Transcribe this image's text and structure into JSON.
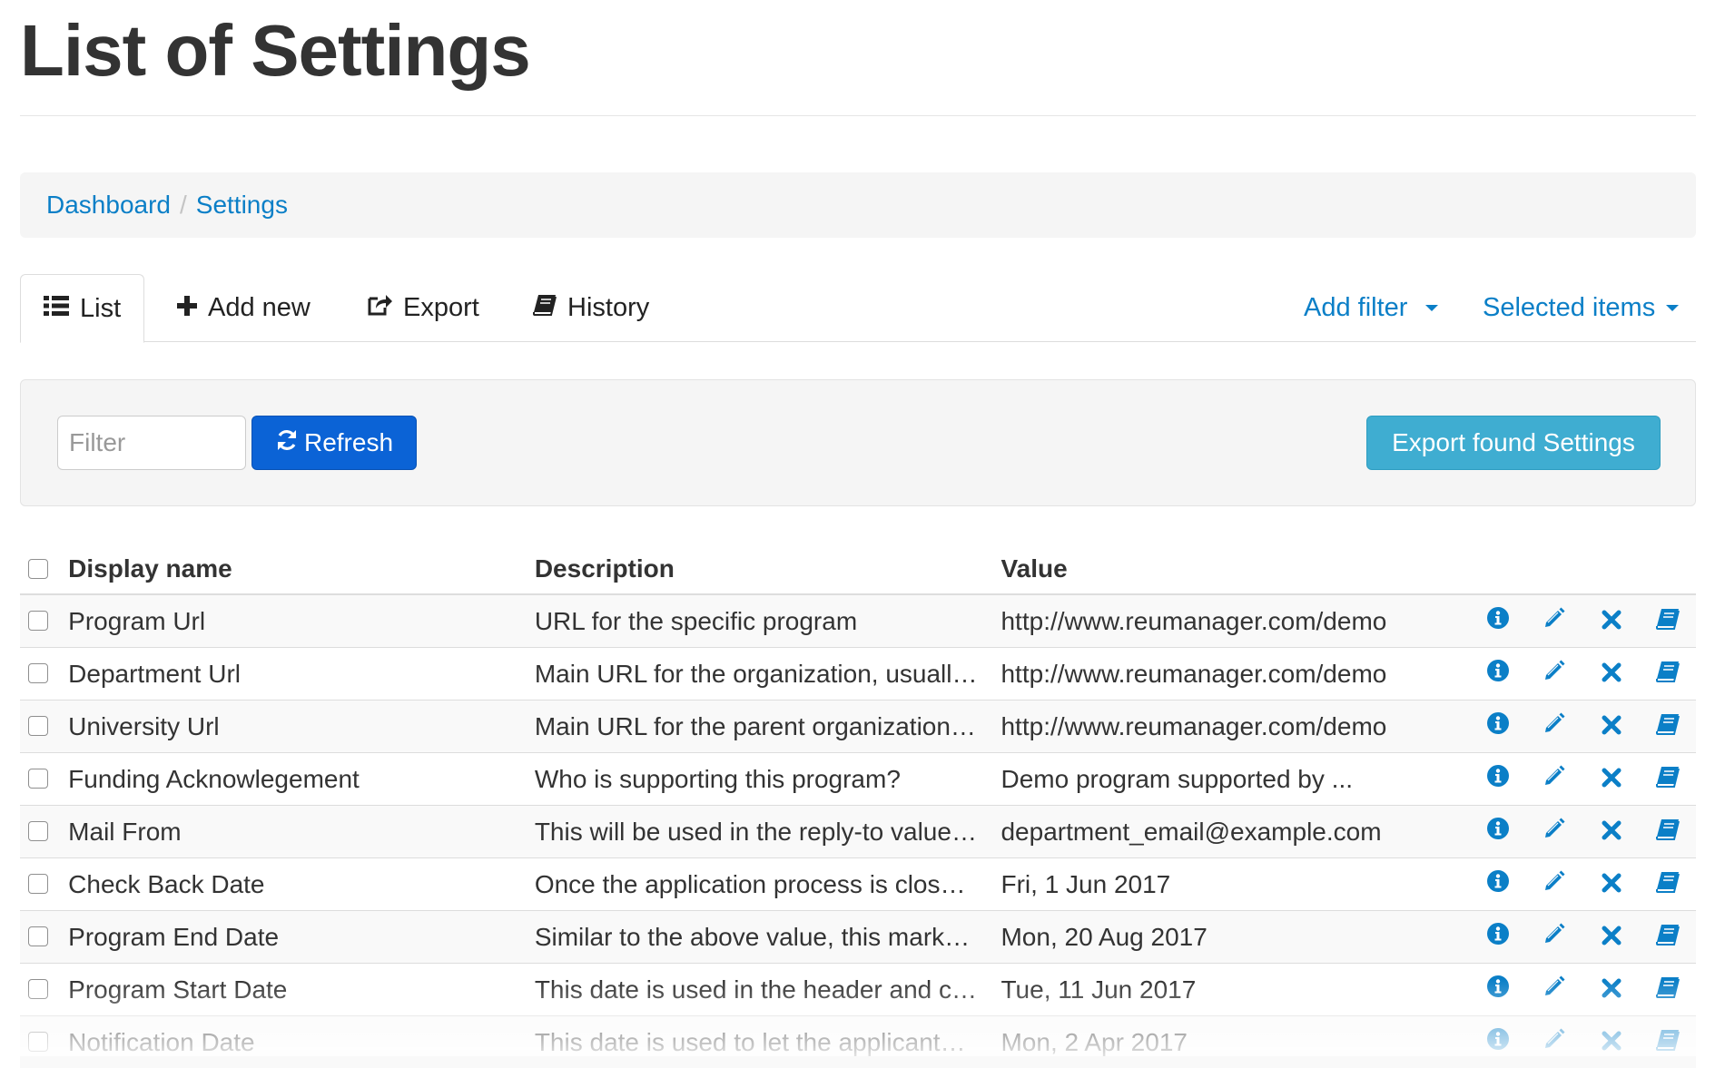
{
  "page": {
    "title": "List of Settings"
  },
  "breadcrumb": {
    "items": [
      "Dashboard",
      "Settings"
    ],
    "separator": "/"
  },
  "tabs": {
    "list": "List",
    "add_new": "Add new",
    "export": "Export",
    "history": "History",
    "add_filter": "Add filter",
    "selected_items": "Selected items"
  },
  "filterbar": {
    "filter_placeholder": "Filter",
    "refresh_label": "Refresh",
    "export_found_label": "Export found Settings"
  },
  "table": {
    "headers": {
      "name": "Display name",
      "description": "Description",
      "value": "Value"
    },
    "rows": [
      {
        "name": "Program Url",
        "description": "URL for the specific program",
        "value": "http://www.reumanager.com/demo"
      },
      {
        "name": "Department Url",
        "description": "Main URL for the organization, usuall…",
        "value": "http://www.reumanager.com/demo"
      },
      {
        "name": "University Url",
        "description": "Main URL for the parent organization…",
        "value": "http://www.reumanager.com/demo"
      },
      {
        "name": "Funding Acknowlegement",
        "description": "Who is supporting this program?",
        "value": "Demo program supported by ..."
      },
      {
        "name": "Mail From",
        "description": "This will be used in the reply-to value…",
        "value": "department_email@example.com"
      },
      {
        "name": "Check Back Date",
        "description": "Once the application process is clos…",
        "value": "Fri, 1 Jun 2017"
      },
      {
        "name": "Program End Date",
        "description": "Similar to the above value, this mark…",
        "value": "Mon, 20 Aug 2017"
      },
      {
        "name": "Program Start Date",
        "description": "This date is used in the header and c…",
        "value": "Tue, 11 Jun 2017"
      },
      {
        "name": "Notification Date",
        "description": "This date is used to let the applicant…",
        "value": "Mon, 2 Apr 2017"
      }
    ],
    "row_actions": [
      "info-icon",
      "pencil-icon",
      "x-icon",
      "book-icon"
    ]
  },
  "colors": {
    "link": "#0b7fc7",
    "primary": "#0b63d6",
    "info": "#3fadd1",
    "text": "#333333"
  }
}
